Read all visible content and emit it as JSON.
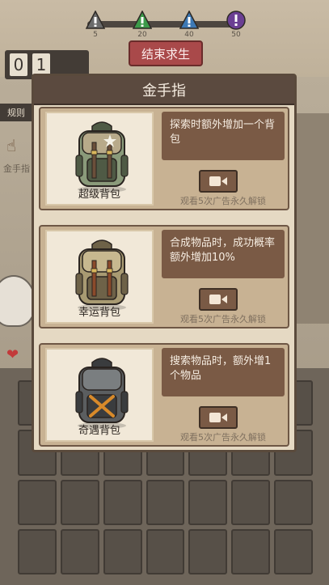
{
  "top_bar": {
    "markers": [
      {
        "icon": "warning-icon-gray",
        "value": "5",
        "color": "#6b6b6b"
      },
      {
        "icon": "warning-icon-green",
        "value": "20",
        "color": "#3c9a4a"
      },
      {
        "icon": "warning-icon-blue",
        "value": "40",
        "color": "#3d79b5"
      },
      {
        "icon": "exclaim-icon-purple",
        "value": "50",
        "color": "#6b3f93"
      }
    ],
    "end_button": "结束求生",
    "counter_digits": [
      "0",
      "1"
    ]
  },
  "side": {
    "rules_label": "规则",
    "cheat_label": "金手指"
  },
  "modal": {
    "title": "金手指",
    "cards": [
      {
        "name": "超级背包",
        "description": "探索时额外增加一个背包",
        "unlock_note": "观看5次广告永久解锁",
        "colors": {
          "body": "#8a9a7a",
          "dark": "#4f5a45",
          "strap": "#6b4f3a",
          "accent": "#b8aa8a"
        }
      },
      {
        "name": "幸运背包",
        "description": "合成物品时，成功概率额外增加10%",
        "unlock_note": "观看5次广告永久解锁",
        "colors": {
          "body": "#a89a72",
          "dark": "#6e6248",
          "strap": "#8b4a2b",
          "accent": "#c7b88f"
        }
      },
      {
        "name": "奇遇背包",
        "description": "搜索物品时，额外增1个物品",
        "unlock_note": "观看5次广告永久解锁",
        "colors": {
          "body": "#5b5e60",
          "dark": "#3a3c3e",
          "strap": "#d88a2a",
          "accent": "#7a7e80"
        }
      }
    ]
  },
  "colors": {
    "modal_header": "#5b4a3f",
    "desc_box": "#7a5a45",
    "end_button": "#a9494a"
  }
}
